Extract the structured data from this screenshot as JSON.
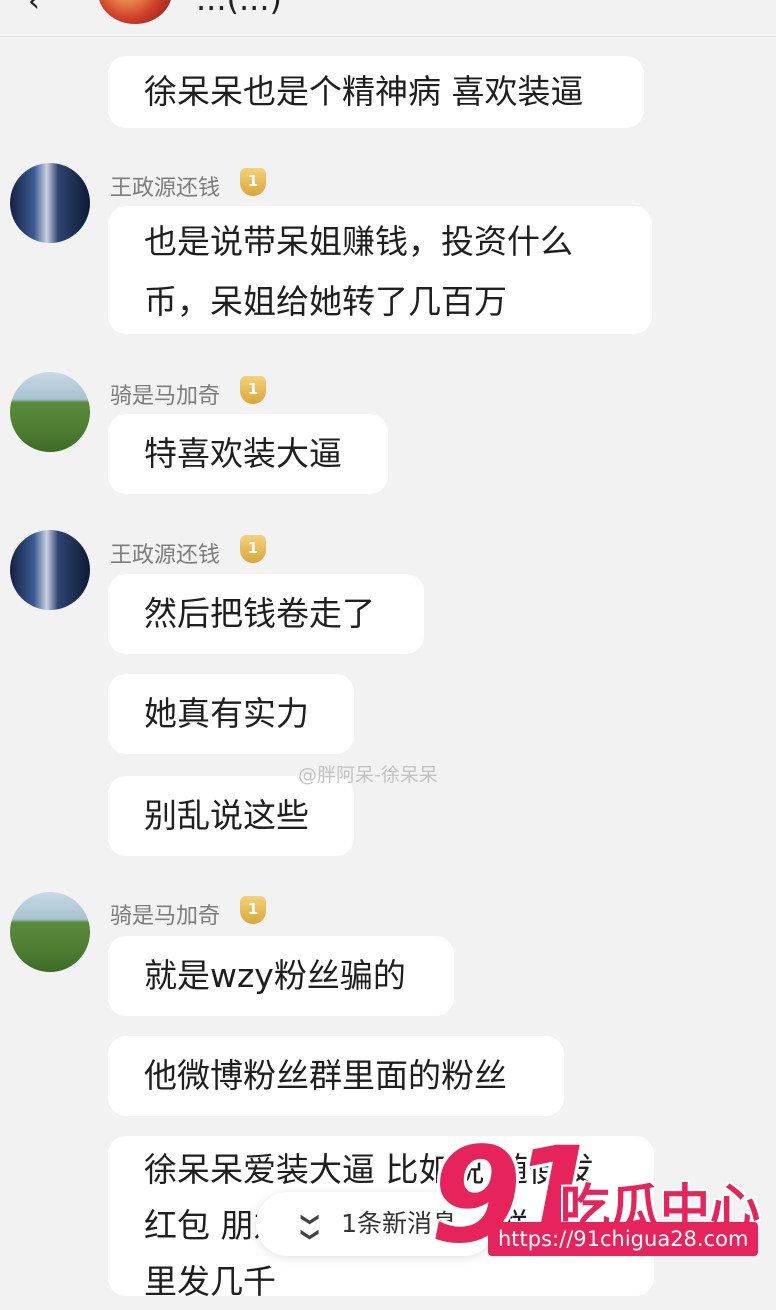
{
  "header": {
    "title": "...(...)",
    "back_label": "‹"
  },
  "messages": [
    {
      "text": "徐呆呆也是个精神病 喜欢装逼"
    },
    {
      "sender": "王政源还钱",
      "lines": [
        "也是说带呆姐赚钱，投资什么",
        "币，呆姐给她转了几百万"
      ]
    },
    {
      "sender": "骑是马加奇",
      "text": "特喜欢装大逼"
    },
    {
      "sender": "王政源还钱",
      "texts": [
        "然后把钱卷走了",
        "她真有实力",
        "别乱说这些"
      ]
    },
    {
      "sender": "骑是马加奇",
      "texts": [
        "就是wzy粉丝骗的",
        "他微博粉丝群里面的粉丝"
      ]
    },
    {
      "lines": [
        "徐呆呆爱装大逼 比如说 随便发",
        "红包 朋友圈 一天到晚在群",
        "里发几千"
      ]
    }
  ],
  "badge_glyph": "1",
  "watermark": "@胖阿呆-徐呆呆",
  "new_message_bar": {
    "label": "1条新消息",
    "icon": "double-chevron-down-icon"
  },
  "logo": {
    "number": "91",
    "name": "吃瓜中心",
    "url": "https://91chigua28.com"
  },
  "colors": {
    "bubble": "#ffffff",
    "background": "#f2f2f2",
    "brand": "#e6235a",
    "badge": "#e3b04f"
  }
}
